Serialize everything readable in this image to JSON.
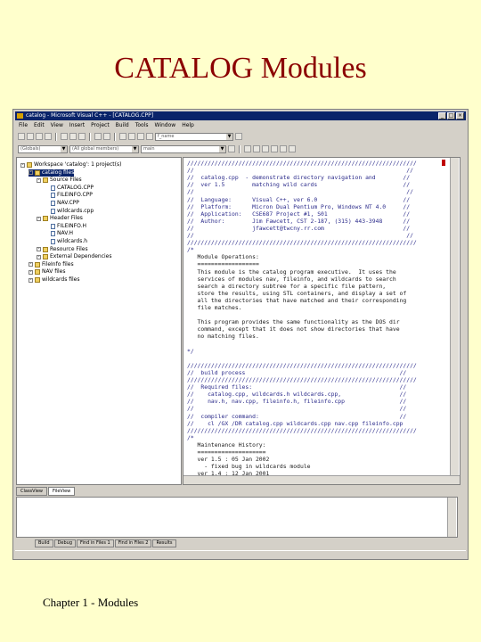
{
  "slide": {
    "title": "CATALOG Modules",
    "footer": "Chapter 1 - Modules",
    "title_color": "#8b0000",
    "background": "#ffffcc"
  },
  "window": {
    "title": "catalog - Microsoft Visual C++ - [CATALOG.CPP]",
    "buttons": [
      "_",
      "□",
      "×"
    ],
    "menu": [
      "File",
      "Edit",
      "View",
      "Insert",
      "Project",
      "Build",
      "Tools",
      "Window",
      "Help"
    ],
    "find_combo": "f_name",
    "scope_combo": "(Globals)",
    "members_combo": "(All global members)",
    "function_combo": "main",
    "workspace_tabs": [
      "ClassView",
      "FileView"
    ],
    "output_tabs": [
      "Build",
      "Debug",
      "Find in Files 1",
      "Find in Files 2",
      "Results"
    ],
    "tree": [
      {
        "label": "Workspace 'catalog': 1 project(s)",
        "depth": 0,
        "kind": "folder"
      },
      {
        "label": "catalog files",
        "depth": 1,
        "kind": "folder",
        "selected": true
      },
      {
        "label": "Source Files",
        "depth": 2,
        "kind": "folder"
      },
      {
        "label": "CATALOG.CPP",
        "depth": 3,
        "kind": "file"
      },
      {
        "label": "FILEINFO.CPP",
        "depth": 3,
        "kind": "file"
      },
      {
        "label": "NAV.CPP",
        "depth": 3,
        "kind": "file"
      },
      {
        "label": "wildcards.cpp",
        "depth": 3,
        "kind": "file"
      },
      {
        "label": "Header Files",
        "depth": 2,
        "kind": "folder"
      },
      {
        "label": "FILEINFO.H",
        "depth": 3,
        "kind": "file"
      },
      {
        "label": "NAV.H",
        "depth": 3,
        "kind": "file"
      },
      {
        "label": "wildcards.h",
        "depth": 3,
        "kind": "file"
      },
      {
        "label": "Resource Files",
        "depth": 2,
        "kind": "folder"
      },
      {
        "label": "External Dependencies",
        "depth": 2,
        "kind": "folder"
      },
      {
        "label": "FileInfo files",
        "depth": 1,
        "kind": "folder"
      },
      {
        "label": "NAV files",
        "depth": 1,
        "kind": "folder"
      },
      {
        "label": "wildcards files",
        "depth": 1,
        "kind": "folder"
      }
    ]
  },
  "code": [
    "///////////////////////////////////////////////////////////////////",
    "//                                                              //",
    "//  catalog.cpp  - demonstrate directory navigation and        //",
    "//  ver 1.5        matching wild cards                         //",
    "//                                                              //",
    "//  Language:      Visual C++, ver 6.0                         //",
    "//  Platform:      Micron Dual Pentium Pro, Windows NT 4.0     //",
    "//  Application:   CSE687 Project #1, S01                      //",
    "//  Author:        Jim Fawcett, CST 2-187, (315) 443-3948      //",
    "//                 jfawcett@twcny.rr.com                       //",
    "//                                                              //",
    "///////////////////////////////////////////////////////////////////",
    "/*",
    "   Module Operations:",
    "   ==================",
    "   This module is the catalog program executive.  It uses the",
    "   services of modules nav, fileinfo, and wildcards to search",
    "   search a directory subtree for a specific file pattern,",
    "   store the results, using STL containers, and display a set of",
    "   all the directories that have matched and their corresponding",
    "   file matches.",
    "",
    "   This program provides the same functionality as the DOS dir",
    "   command, except that it does not show directories that have",
    "   no matching files.",
    "",
    "*/",
    "",
    "///////////////////////////////////////////////////////////////////",
    "//  build process                                             //",
    "///////////////////////////////////////////////////////////////////",
    "//  Required files:                                           //",
    "//    catalog.cpp, wildcards.h wildcards.cpp,                 //",
    "//    nav.h, nav.cpp, fileinfo.h, fileinfo.cpp                //",
    "//                                                            //",
    "//  compiler command:                                         //",
    "//    cl /GX /DR catalog.cpp wildcards.cpp nav.cpp fileinfo.cpp",
    "///////////////////////////////////////////////////////////////////",
    "/*",
    "   Maintenance History:",
    "   ====================",
    "   ver 1.5 : 05 Jan 2002",
    "     - fixed bug in wildcards module",
    "   ver 1.4 : 12 Jan 2001"
  ]
}
